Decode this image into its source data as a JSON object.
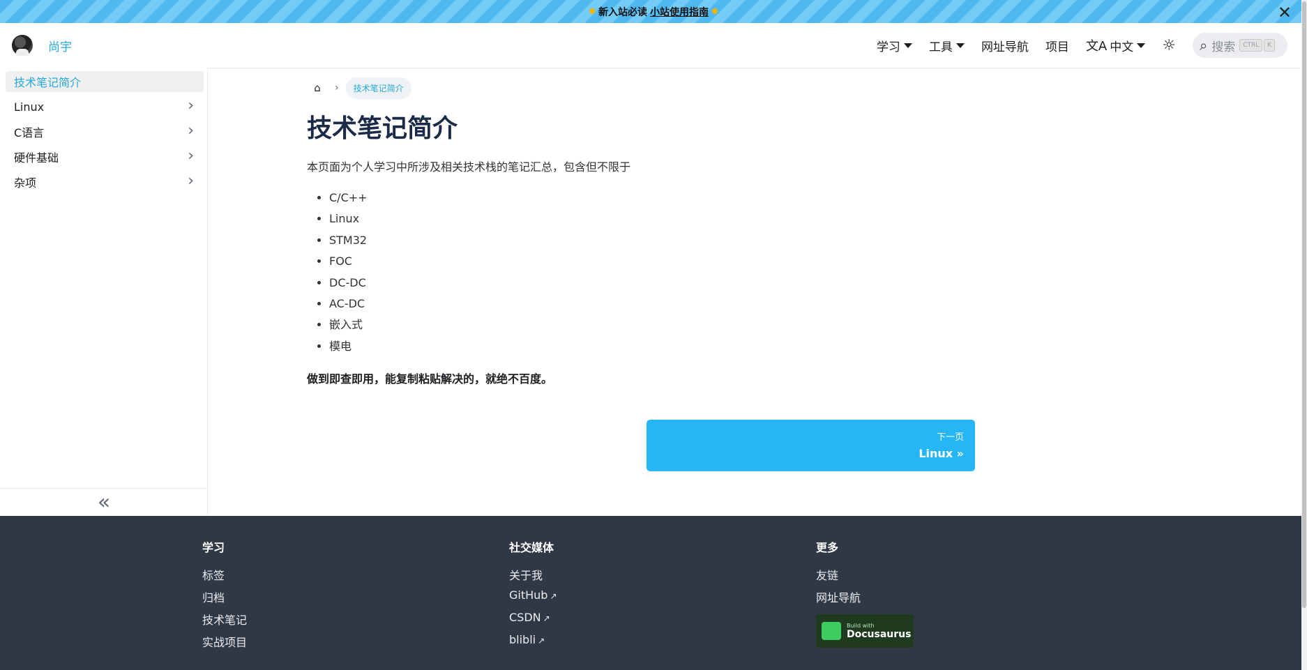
{
  "announcement": {
    "star": "✸",
    "text": "新入站必读",
    "link": "小站使用指南",
    "close": "✕"
  },
  "navbar": {
    "brand": "尚宇",
    "items": [
      "学习",
      "工具",
      "网址导航",
      "项目"
    ],
    "lang": "中文",
    "search_placeholder": "搜索",
    "kbd_ctrl": "CTRL",
    "kbd_k": "K"
  },
  "sidebar": {
    "items": [
      {
        "label": "技术笔记简介"
      },
      {
        "label": "Linux"
      },
      {
        "label": "C语言"
      },
      {
        "label": "硬件基础"
      },
      {
        "label": "杂项"
      }
    ],
    "collapse": "«"
  },
  "main": {
    "breadcrumb_current": "技术笔记简介",
    "title": "技术笔记简介",
    "intro": "本页面为个人学习中所涉及相关技术栈的笔记汇总，包含但不限于",
    "list": [
      "C/C++",
      "Linux",
      "STM32",
      "FOC",
      "DC-DC",
      "AC-DC",
      "嵌入式",
      "模电"
    ],
    "motto": "做到即查即用，能复制粘贴解决的，就绝不百度。",
    "next_sub": "下一页",
    "next_label": "Linux »"
  },
  "footer": {
    "col1": {
      "title": "学习",
      "links": [
        "标签",
        "归档",
        "技术笔记",
        "实战项目"
      ]
    },
    "col2": {
      "title": "社交媒体",
      "links": [
        "关于我",
        "GitHub",
        "CSDN",
        "blibli"
      ]
    },
    "col3": {
      "title": "更多",
      "links": [
        "友链",
        "网址导航"
      ]
    },
    "badge_small": "Build with",
    "badge_big": "Docusaurus"
  }
}
